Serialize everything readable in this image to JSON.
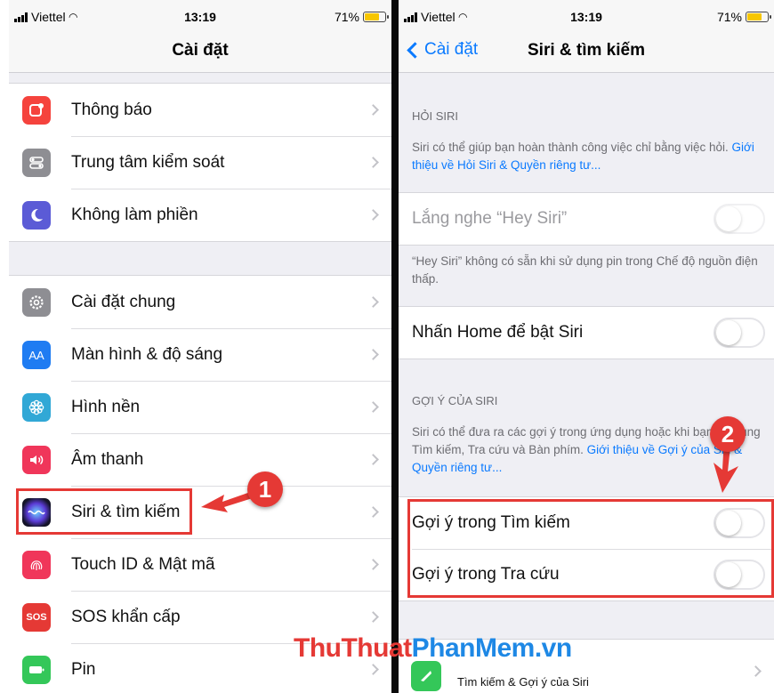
{
  "status": {
    "carrier": "Viettel",
    "time": "13:19",
    "battery": "71%"
  },
  "left": {
    "title": "Cài đặt",
    "group1": [
      {
        "label": "Thông báo",
        "icon": "notifications-icon",
        "color": "#f5433d"
      },
      {
        "label": "Trung tâm kiểm soát",
        "icon": "control-center-icon",
        "color": "#8e8e93"
      },
      {
        "label": "Không làm phiền",
        "icon": "moon-icon",
        "color": "#5b5bd6"
      }
    ],
    "group2": [
      {
        "label": "Cài đặt chung",
        "icon": "gear-icon",
        "color": "#8e8e93"
      },
      {
        "label": "Màn hình & độ sáng",
        "icon": "display-icon",
        "glyph": "AA",
        "color": "#1f7cf2"
      },
      {
        "label": "Hình nền",
        "icon": "wallpaper-icon",
        "color": "#31a8d6"
      },
      {
        "label": "Âm thanh",
        "icon": "sound-icon",
        "color": "#f0365a"
      },
      {
        "label": "Siri & tìm kiếm",
        "icon": "siri-icon",
        "color": "#1b1b3a"
      },
      {
        "label": "Touch ID & Mật mã",
        "icon": "fingerprint-icon",
        "color": "#f0365a"
      },
      {
        "label": "SOS khẩn cấp",
        "icon": "sos-icon",
        "glyph": "SOS",
        "color": "#e53935"
      },
      {
        "label": "Pin",
        "icon": "battery-icon",
        "color": "#34c759"
      }
    ]
  },
  "right": {
    "back_label": "Cài đặt",
    "title": "Siri & tìm kiếm",
    "ask_header": "HỎI SIRI",
    "ask_desc": "Siri có thể giúp bạn hoàn thành công việc chỉ bằng việc hỏi.",
    "ask_link": "Giới thiệu về Hỏi Siri & Quyền riêng tư...",
    "hey_siri": "Lắng nghe “Hey Siri”",
    "hey_note": "“Hey Siri” không có sẵn khi sử dụng pin trong Chế độ nguồn điện thấp.",
    "home_siri": "Nhấn Home để bật Siri",
    "sugg_header": "GỢI Ý CỦA SIRI",
    "sugg_desc": "Siri có thể đưa ra các gợi ý trong ứng dụng hoặc khi bạn sử dụng Tìm kiếm, Tra cứu và Bàn phím.",
    "sugg_link": "Giới thiệu về Gợi ý của Siri & Quyền riêng tư...",
    "sugg_search": "Gợi ý trong Tìm kiếm",
    "sugg_lookup": "Gợi ý trong Tra cứu",
    "bottom_sub": "Tìm kiếm & Gợi ý của Siri"
  },
  "annotations": {
    "step1": "1",
    "step2": "2"
  },
  "watermark": {
    "part1": "ThuThuat",
    "part2": "PhanMem",
    "part3": ".vn"
  },
  "colors": {
    "accent": "#0a7aff",
    "annotation": "#e53935"
  }
}
